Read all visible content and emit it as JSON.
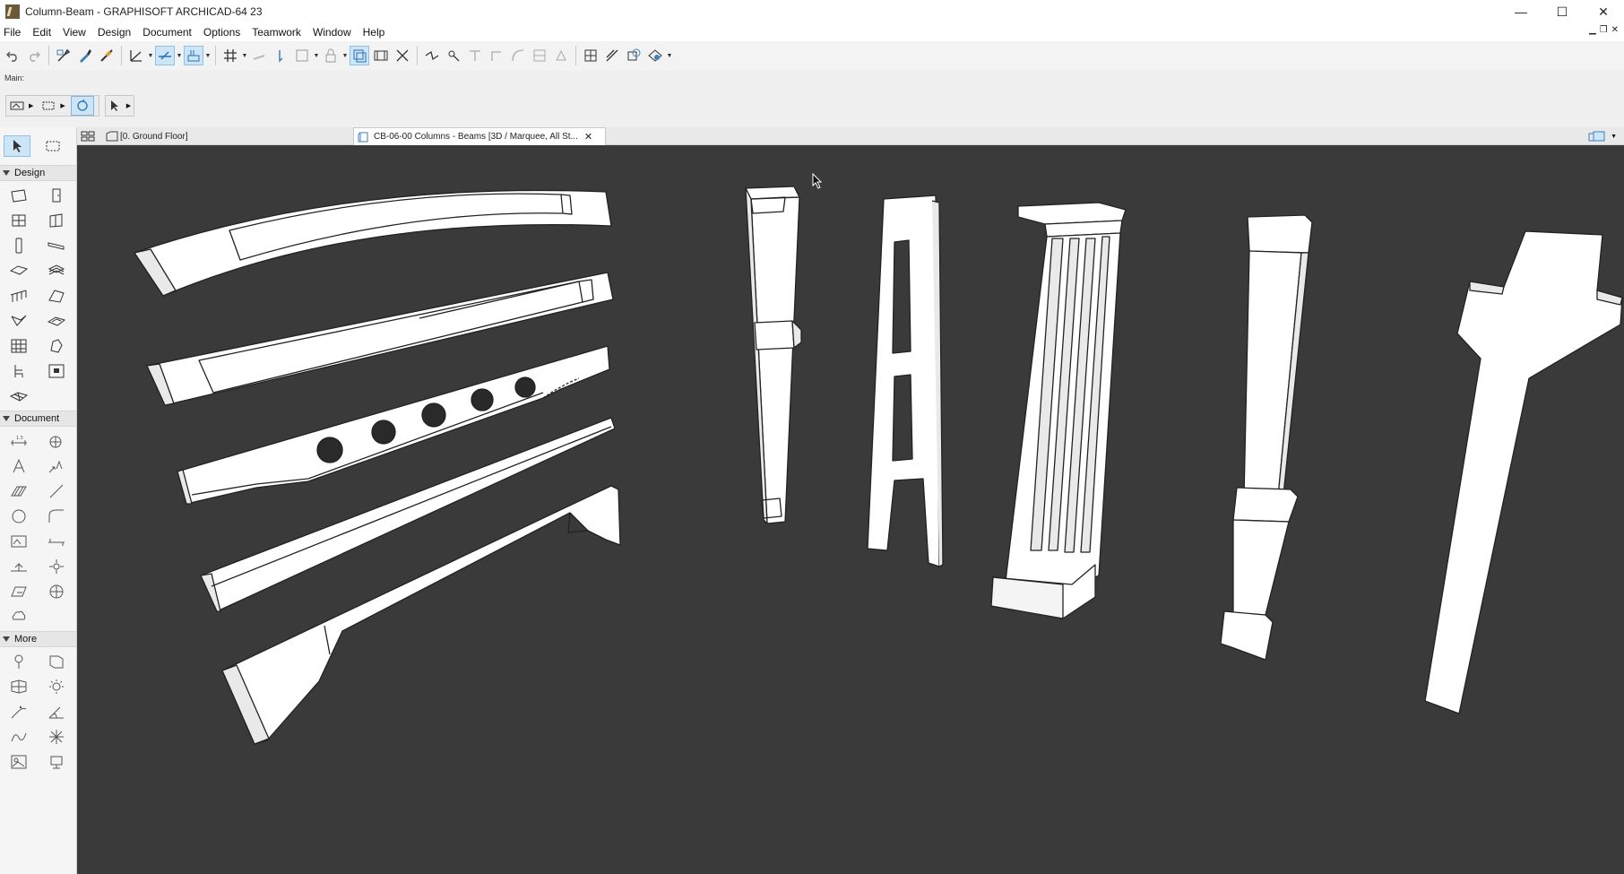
{
  "window": {
    "title": "Column-Beam - GRAPHISOFT ARCHICAD-64 23",
    "controls": {
      "minimize": "—",
      "maximize": "☐",
      "close": "✕"
    }
  },
  "menu": {
    "items": [
      "File",
      "Edit",
      "View",
      "Design",
      "Document",
      "Options",
      "Teamwork",
      "Window",
      "Help"
    ]
  },
  "toolbar": {
    "main_label": "Main:"
  },
  "left_panel": {
    "sections": {
      "design": "Design",
      "document": "Document",
      "more": "More"
    }
  },
  "tabs": {
    "floor_plan": "[0. Ground Floor]",
    "view_3d": "CB-06-00 Columns - Beams [3D / Marquee, All St...",
    "close": "✕"
  },
  "colors": {
    "viewport_bg": "#3a3a3a",
    "model_face": "#ffffff",
    "model_edge": "#222222",
    "active_tool": "#cde6f7"
  }
}
